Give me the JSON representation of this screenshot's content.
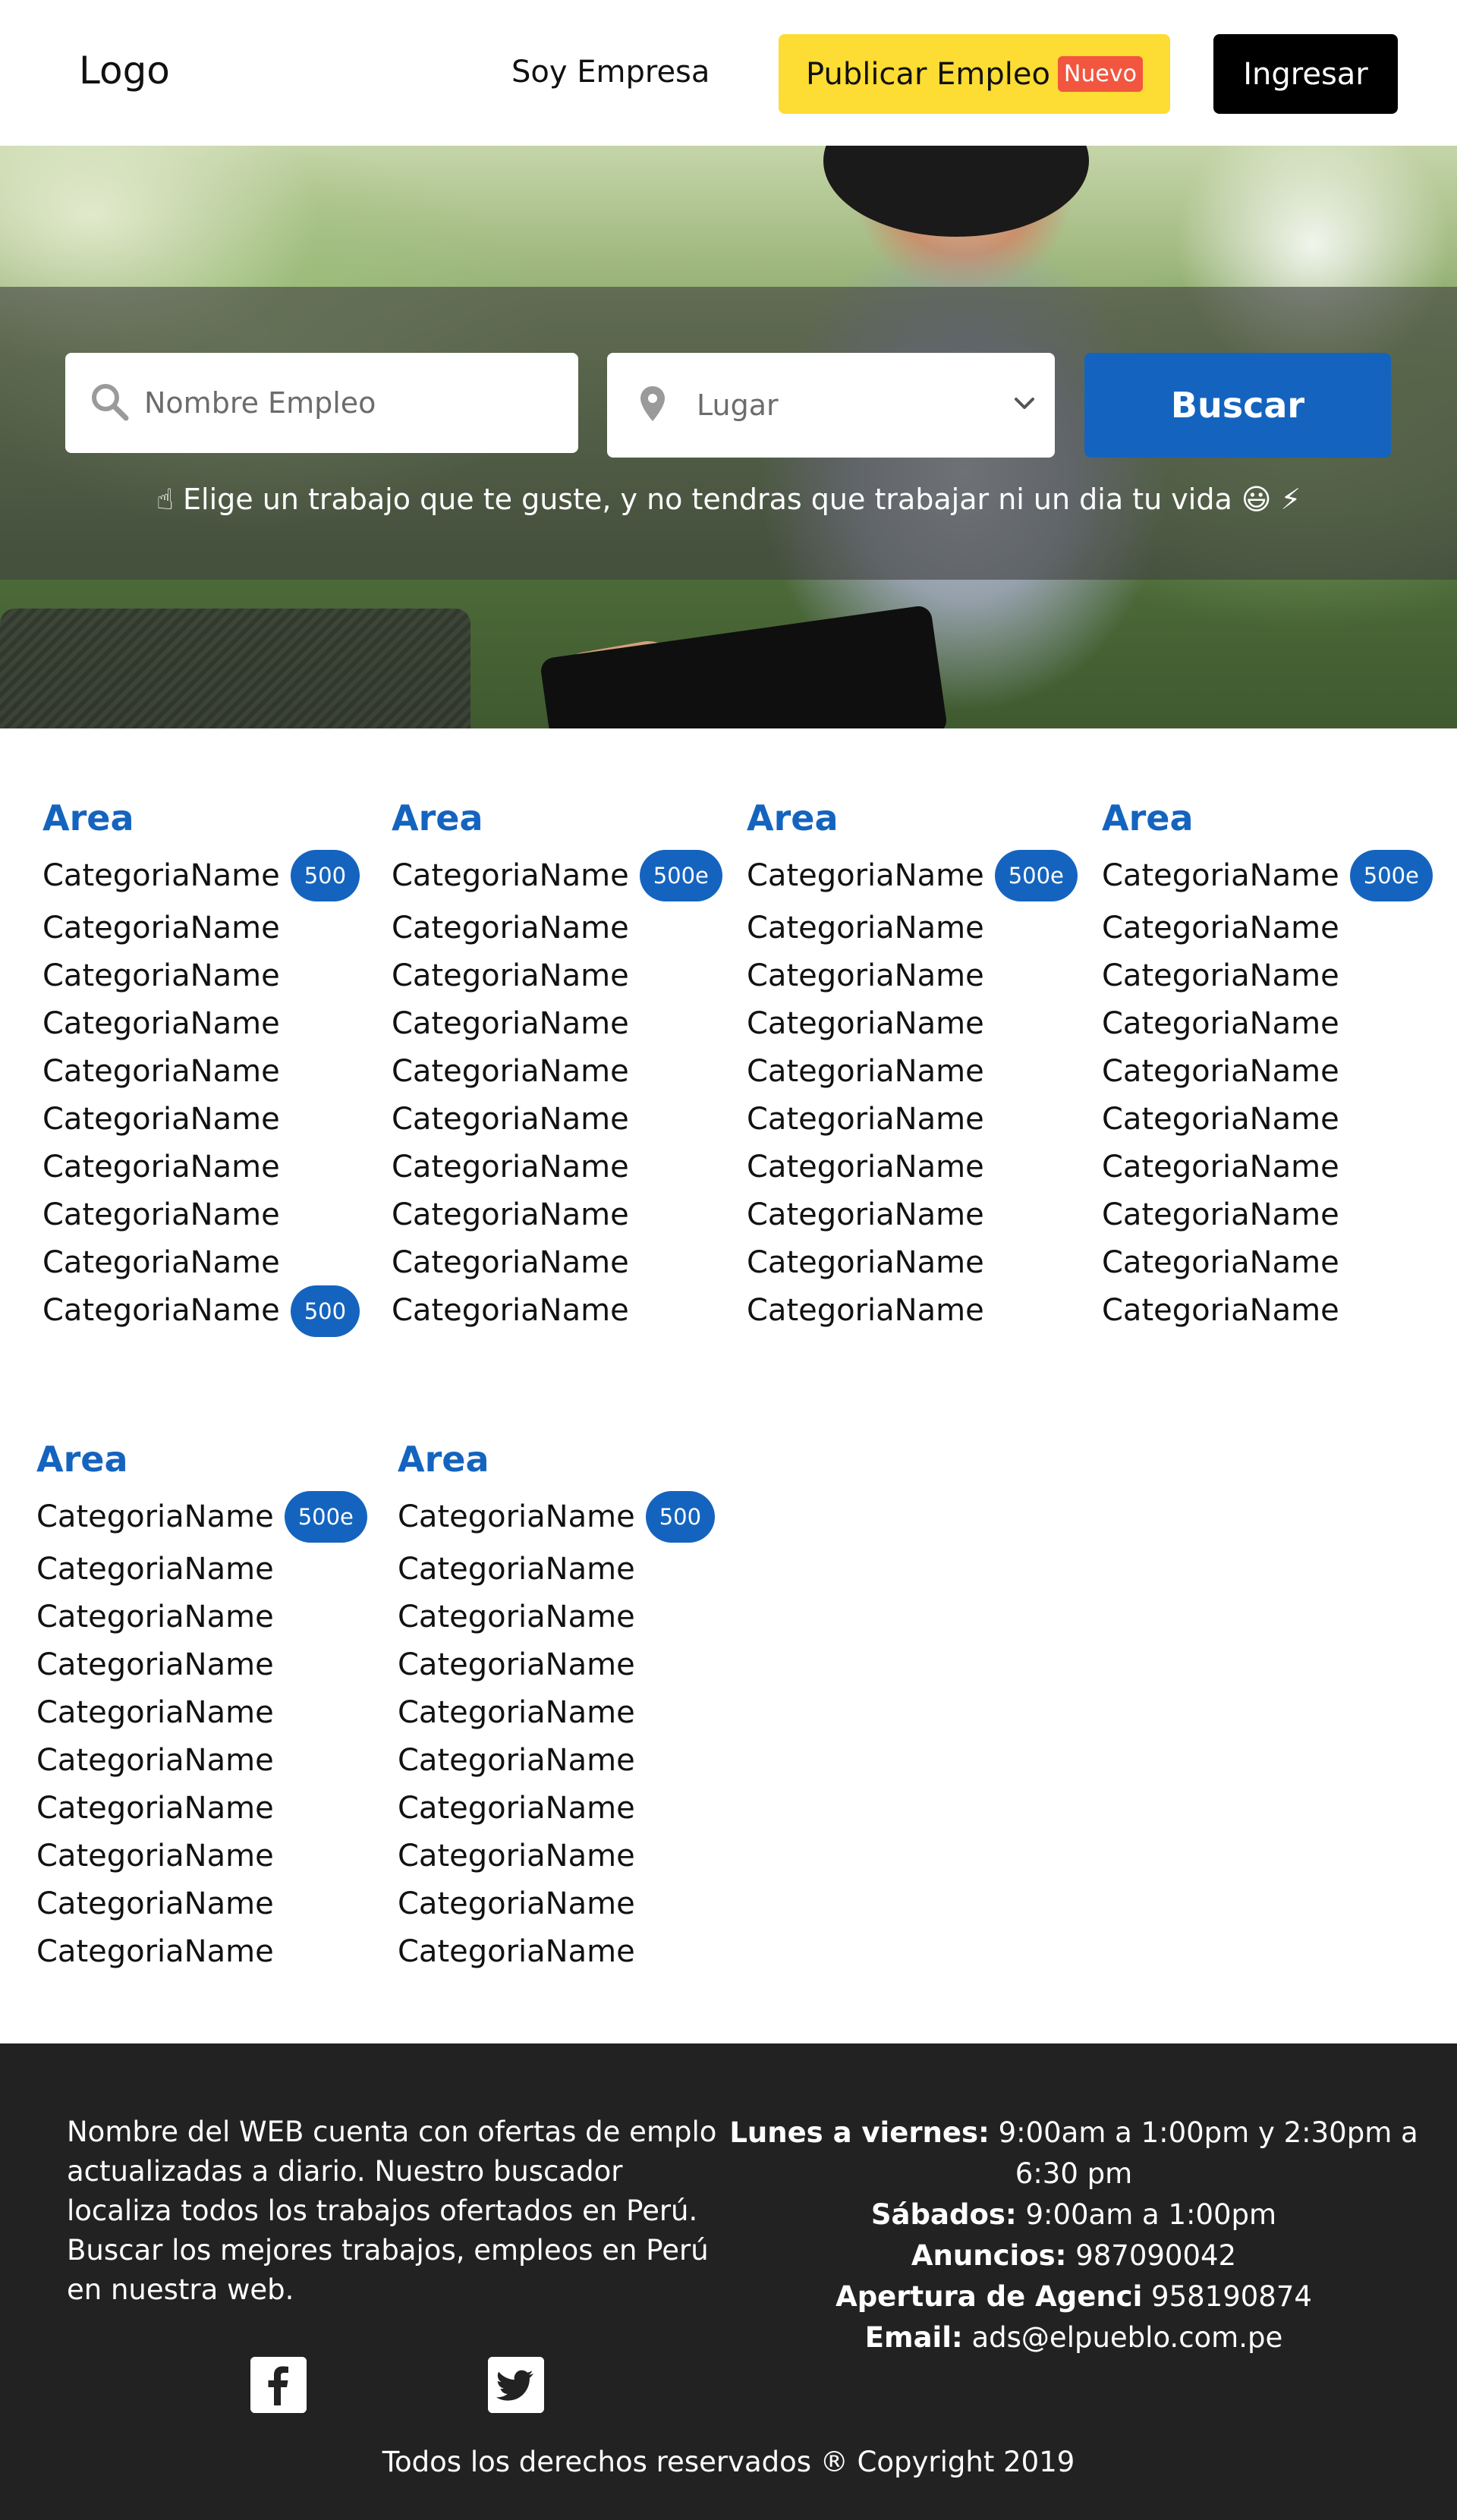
{
  "header": {
    "logo": "Logo",
    "soy_empresa": "Soy Empresa",
    "publicar_label": "Publicar Empleo",
    "nuevo_badge": "Nuevo",
    "ingresar_label": "Ingresar"
  },
  "hero": {
    "search_placeholder": "Nombre Empleo",
    "location_placeholder": "Lugar",
    "buscar_label": "Buscar",
    "tagline_point": "☝",
    "tagline": "Elige un trabajo que te guste, y no tendras que trabajar ni un dia tu vida",
    "tagline_emojis": "😃 ⚡"
  },
  "areas": [
    {
      "title": "Area",
      "items": [
        {
          "name": "CategoriaName",
          "count": "500"
        },
        {
          "name": "CategoriaName"
        },
        {
          "name": "CategoriaName"
        },
        {
          "name": "CategoriaName"
        },
        {
          "name": "CategoriaName"
        },
        {
          "name": "CategoriaName"
        },
        {
          "name": "CategoriaName"
        },
        {
          "name": "CategoriaName"
        },
        {
          "name": "CategoriaName"
        },
        {
          "name": "CategoriaName",
          "count": "500"
        }
      ]
    },
    {
      "title": "Area",
      "items": [
        {
          "name": "CategoriaName",
          "count": "500e"
        },
        {
          "name": "CategoriaName"
        },
        {
          "name": "CategoriaName"
        },
        {
          "name": "CategoriaName"
        },
        {
          "name": "CategoriaName"
        },
        {
          "name": "CategoriaName"
        },
        {
          "name": "CategoriaName"
        },
        {
          "name": "CategoriaName"
        },
        {
          "name": "CategoriaName"
        },
        {
          "name": "CategoriaName"
        }
      ]
    },
    {
      "title": "Area",
      "items": [
        {
          "name": "CategoriaName",
          "count": "500e"
        },
        {
          "name": "CategoriaName"
        },
        {
          "name": "CategoriaName"
        },
        {
          "name": "CategoriaName"
        },
        {
          "name": "CategoriaName"
        },
        {
          "name": "CategoriaName"
        },
        {
          "name": "CategoriaName"
        },
        {
          "name": "CategoriaName"
        },
        {
          "name": "CategoriaName"
        },
        {
          "name": "CategoriaName"
        }
      ]
    },
    {
      "title": "Area",
      "items": [
        {
          "name": "CategoriaName",
          "count": "500e"
        },
        {
          "name": "CategoriaName"
        },
        {
          "name": "CategoriaName"
        },
        {
          "name": "CategoriaName"
        },
        {
          "name": "CategoriaName"
        },
        {
          "name": "CategoriaName"
        },
        {
          "name": "CategoriaName"
        },
        {
          "name": "CategoriaName"
        },
        {
          "name": "CategoriaName"
        },
        {
          "name": "CategoriaName"
        }
      ]
    },
    {
      "title": "Area",
      "items": [
        {
          "name": "CategoriaName",
          "count": "500e"
        },
        {
          "name": "CategoriaName"
        },
        {
          "name": "CategoriaName"
        },
        {
          "name": "CategoriaName"
        },
        {
          "name": "CategoriaName"
        },
        {
          "name": "CategoriaName"
        },
        {
          "name": "CategoriaName"
        },
        {
          "name": "CategoriaName"
        },
        {
          "name": "CategoriaName"
        },
        {
          "name": "CategoriaName"
        }
      ]
    },
    {
      "title": "Area",
      "items": [
        {
          "name": "CategoriaName",
          "count": "500"
        },
        {
          "name": "CategoriaName"
        },
        {
          "name": "CategoriaName"
        },
        {
          "name": "CategoriaName"
        },
        {
          "name": "CategoriaName"
        },
        {
          "name": "CategoriaName"
        },
        {
          "name": "CategoriaName"
        },
        {
          "name": "CategoriaName"
        },
        {
          "name": "CategoriaName"
        },
        {
          "name": "CategoriaName"
        }
      ]
    }
  ],
  "footer": {
    "about": "Nombre del WEB cuenta con ofertas de emplo actualizadas a diario. Nuestro buscador localiza todos los trabajos ofertados en Perú. Buscar los mejores trabajos, empleos en Perú en nuestra web.",
    "weekdays_label": "Lunes a viernes:",
    "weekdays_value": "9:00am a 1:00pm y 2:30pm a 6:30 pm",
    "saturday_label": "Sábados:",
    "saturday_value": "9:00am a 1:00pm",
    "anuncios_label": "Anuncios:",
    "anuncios_value": "987090042",
    "apertura_label": "Apertura de Agenci",
    "apertura_value": "958190874",
    "email_label": "Email:",
    "email_value": "ads@elpueblo.com.pe",
    "copyright": "Todos los derechos reservados ® Copyright 2019"
  },
  "icons": [
    "search-icon",
    "location-pin-icon",
    "chevron-down-icon",
    "facebook-icon",
    "twitter-icon"
  ],
  "colors": {
    "primary_blue": "#1464bf",
    "publish_yellow": "#fddc33",
    "nuevo_red": "#f2563f",
    "footer_bg": "#222222"
  }
}
